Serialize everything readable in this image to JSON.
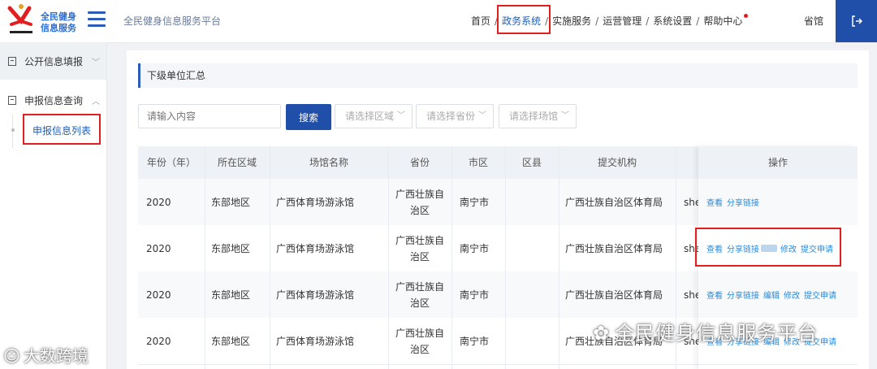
{
  "header": {
    "logo_line1": "全民健身",
    "logo_line2": "信息服务",
    "platform_title": "全民健身信息服务平台",
    "nav": [
      "首页",
      "政务系统",
      "实施服务",
      "运营管理",
      "系统设置",
      "帮助中心"
    ],
    "active_nav": "政务系统",
    "region": "省馆"
  },
  "sidebar": {
    "items": [
      {
        "label": "公开信息填报"
      },
      {
        "label": "申报信息查询"
      }
    ],
    "sub_item": "申报信息列表"
  },
  "main": {
    "section_title": "下级单位汇总",
    "search": {
      "placeholder": "请输入内容",
      "button": "搜索"
    },
    "filters": [
      "请选择区域",
      "请选择省份",
      "请选择场馆"
    ],
    "table": {
      "headers": [
        "年份（年）",
        "所在区域",
        "场馆名称",
        "省份",
        "市区",
        "区县",
        "提交机构",
        "",
        "操作"
      ],
      "rows": [
        {
          "year": "2020",
          "area": "东部地区",
          "venue": "广西体育场游泳馆",
          "province": "广西壮族自治区",
          "city": "南宁市",
          "county": "",
          "org": "广西壮族自治区体育局",
          "extra": "shen",
          "ops": [
            "查看",
            "分享链接"
          ]
        },
        {
          "year": "2020",
          "area": "东部地区",
          "venue": "广西体育场游泳馆",
          "province": "广西壮族自治区",
          "city": "南宁市",
          "county": "",
          "org": "广西壮族自治区体育局",
          "extra": "shen",
          "ops": [
            "查看",
            "分享链接",
            "修改",
            "提交申请"
          ]
        },
        {
          "year": "2020",
          "area": "东部地区",
          "venue": "广西体育场游泳馆",
          "province": "广西壮族自治区",
          "city": "南宁市",
          "county": "",
          "org": "广西壮族自治区体育局",
          "extra": "shen",
          "ops": [
            "查看",
            "分享链接",
            "编辑",
            "修改",
            "提交申请"
          ]
        },
        {
          "year": "2020",
          "area": "东部地区",
          "venue": "广西体育场游泳馆",
          "province": "广西壮族自治区",
          "city": "南宁市",
          "county": "",
          "org": "广西壮族自治区体育局",
          "extra": "shen",
          "ops": [
            "查看",
            "分享链接",
            "编辑",
            "修改",
            "提交申请"
          ]
        }
      ]
    }
  },
  "watermarks": {
    "right": "全民健身信息服务平台",
    "left": "大数跨境"
  },
  "colors": {
    "primary": "#1f4fa8",
    "link": "#2a8ad6",
    "highlight": "#e02020"
  }
}
